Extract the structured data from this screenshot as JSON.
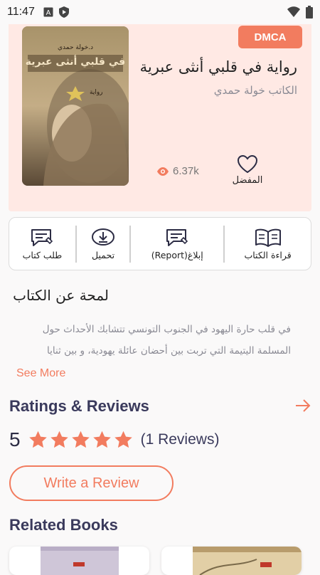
{
  "status_bar": {
    "time": "11:47",
    "left_icons": [
      "a-square-icon",
      "shield-play-icon"
    ],
    "right_icons": [
      "wifi-icon",
      "battery-icon"
    ]
  },
  "book": {
    "title": "رواية في قلبي أنثى عبرية",
    "author": "الكاتب خولة حمدي",
    "dmca_label": "DMCA",
    "views": "6.37k",
    "favorite_label": "المفضل",
    "cover_text_top": "د.خولة حمدي",
    "cover_text_main": "في قلبي أنثى عبرية",
    "cover_text_badge": "رواية"
  },
  "actions": [
    {
      "label": "طلب كتاب",
      "icon": "message-edit-icon"
    },
    {
      "label": "تحميل",
      "icon": "download-icon"
    },
    {
      "label": "إبلاغ(Report)",
      "icon": "report-icon"
    },
    {
      "label": "قراءة الكتاب",
      "icon": "open-book-icon"
    }
  ],
  "about": {
    "title": "لمحة عن الكتاب",
    "text": "في قلب حارة اليهود في الجنوب التونسي تتشابك الأحداث حول المسلمة اليتيمة التي تربت بين أحضان عائلة يهودية، و بين ثنايا",
    "see_more": "See More"
  },
  "ratings": {
    "title": "Ratings & Reviews",
    "score": "5",
    "stars": 5,
    "reviews_count": "(1 Reviews)",
    "write_review": "Write a Review"
  },
  "related": {
    "title": "Related Books"
  },
  "colors": {
    "accent": "#f27c5f",
    "hero_bg": "#ffe9e4",
    "heading": "#3a3a5c"
  }
}
